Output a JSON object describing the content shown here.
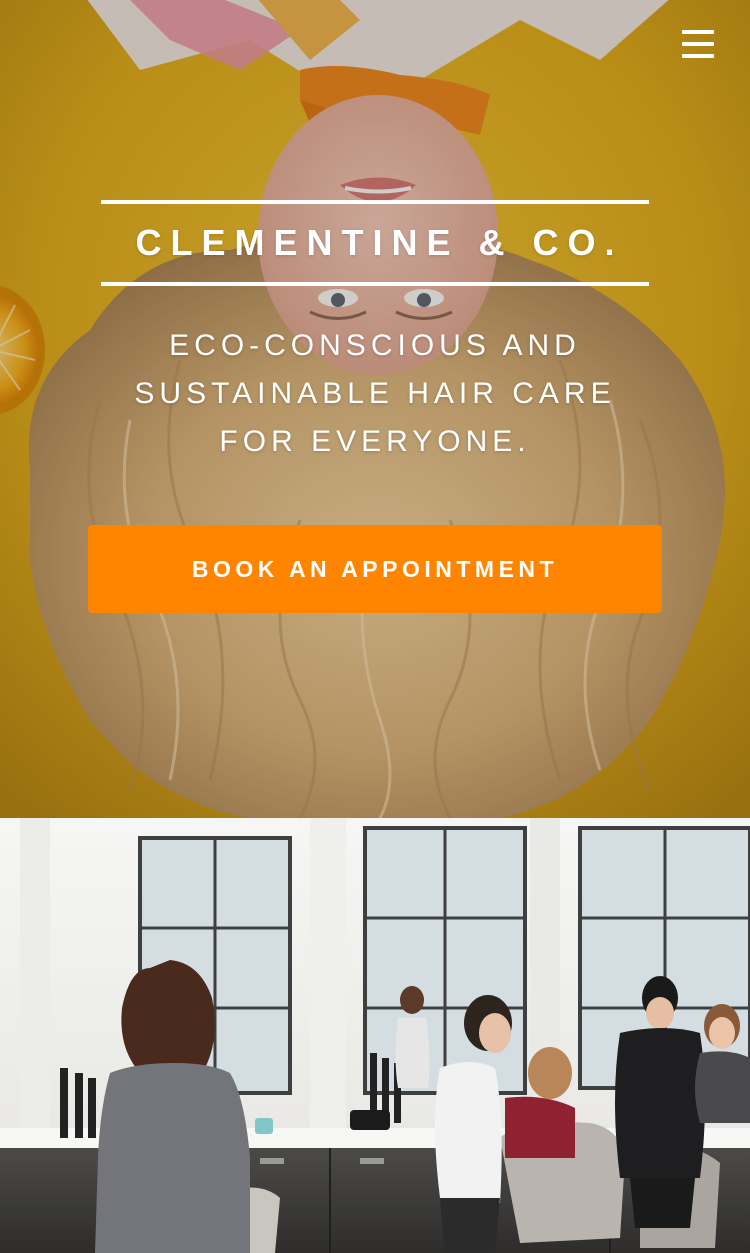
{
  "hero": {
    "brand_title": "CLEMENTINE & CO.",
    "tagline_lines": [
      "ECO-CONSCIOUS AND",
      "SUSTAINABLE HAIR CARE",
      "FOR EVERYONE."
    ],
    "book_label": "BOOK AN APPOINTMENT",
    "icons": {
      "menu": "hamburger-menu-icon"
    }
  },
  "colors": {
    "accent_orange": "#ff8400",
    "hero_yellow": "#e0b21a",
    "text_white": "#ffffff"
  }
}
